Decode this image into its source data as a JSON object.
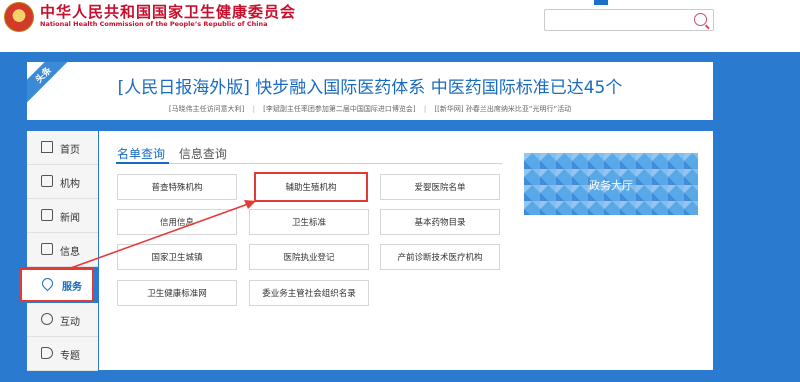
{
  "header": {
    "title": "中华人民共和国国家卫生健康委员会",
    "subtitle": "National Health Commission of the People’s Republic of China",
    "search_placeholder": ""
  },
  "headline": {
    "corner_label": "头条",
    "title": "[人民日报海外版] 快步融入国际医药体系 中医药国际标准已达45个",
    "links": [
      "[马晓伟主任访问意大利]",
      "[李斌副主任率团参加第二届中国国际进口博览会]",
      "[[新华网] 孙春兰出席纳米比亚“光明行”活动"
    ],
    "separator": "|"
  },
  "sidebar": {
    "items": [
      {
        "label": "首页",
        "icon": "house-icon"
      },
      {
        "label": "机构",
        "icon": "org-chart-icon"
      },
      {
        "label": "新闻",
        "icon": "news-icon"
      },
      {
        "label": "信息",
        "icon": "list-icon"
      },
      {
        "label": "服务",
        "icon": "heart-icon",
        "active": true
      },
      {
        "label": "互动",
        "icon": "chat-icon"
      },
      {
        "label": "专题",
        "icon": "tag-icon"
      }
    ]
  },
  "tabs": [
    {
      "label": "名单查询",
      "active": true
    },
    {
      "label": "信息查询",
      "active": false
    }
  ],
  "query_buttons": [
    "普查特殊机构",
    "辅助生殖机构",
    "爱婴医院名单",
    "信用信息",
    "卫生标准",
    "基本药物目录",
    "国家卫生城镇",
    "医院执业登记",
    "产前诊断技术医疗机构",
    "卫生健康标准网",
    "委业务主管社会组织名录"
  ],
  "gov_hall": {
    "label": "政务大厅"
  },
  "colors": {
    "brand_red": "#c8102e",
    "accent_blue": "#1a6bbf",
    "highlight_red": "#e53935",
    "band_blue": "#2a7bd0"
  }
}
